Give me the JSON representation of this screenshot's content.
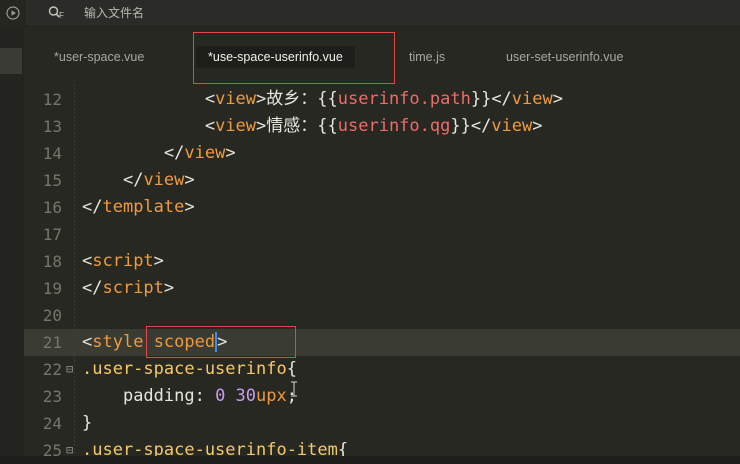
{
  "search": {
    "shortcut_label": "F",
    "placeholder": "输入文件名"
  },
  "tabs": [
    {
      "label": "*user-space.vue",
      "active": false
    },
    {
      "label": "*use-space-userinfo.vue",
      "active": true
    },
    {
      "label": "time.js",
      "active": false
    },
    {
      "label": "user-set-userinfo.vue",
      "active": false
    }
  ],
  "editor": {
    "lines": [
      {
        "num": "12",
        "fold": "",
        "indent": "            ",
        "tokens": [
          [
            "t-tag",
            "<"
          ],
          [
            "t-name",
            "view"
          ],
          [
            "t-tag",
            ">"
          ],
          [
            "t-text",
            "故乡："
          ],
          [
            "t-punct",
            "{{"
          ],
          [
            "t-var",
            "userinfo.path"
          ],
          [
            "t-punct",
            "}}"
          ],
          [
            "t-tag",
            "</"
          ],
          [
            "t-name",
            "view"
          ],
          [
            "t-tag",
            ">"
          ]
        ]
      },
      {
        "num": "13",
        "fold": "",
        "indent": "            ",
        "tokens": [
          [
            "t-tag",
            "<"
          ],
          [
            "t-name",
            "view"
          ],
          [
            "t-tag",
            ">"
          ],
          [
            "t-text",
            "情感："
          ],
          [
            "t-punct",
            "{{"
          ],
          [
            "t-var",
            "userinfo.qg"
          ],
          [
            "t-punct",
            "}}"
          ],
          [
            "t-tag",
            "</"
          ],
          [
            "t-name",
            "view"
          ],
          [
            "t-tag",
            ">"
          ]
        ]
      },
      {
        "num": "14",
        "fold": "",
        "indent": "        ",
        "tokens": [
          [
            "t-tag",
            "</"
          ],
          [
            "t-name",
            "view"
          ],
          [
            "t-tag",
            ">"
          ]
        ]
      },
      {
        "num": "15",
        "fold": "",
        "indent": "    ",
        "tokens": [
          [
            "t-tag",
            "</"
          ],
          [
            "t-name",
            "view"
          ],
          [
            "t-tag",
            ">"
          ]
        ]
      },
      {
        "num": "16",
        "fold": "",
        "indent": "",
        "tokens": [
          [
            "t-tag",
            "</"
          ],
          [
            "t-name",
            "template"
          ],
          [
            "t-tag",
            ">"
          ]
        ]
      },
      {
        "num": "17",
        "fold": "",
        "indent": "",
        "tokens": []
      },
      {
        "num": "18",
        "fold": "",
        "indent": "",
        "tokens": [
          [
            "t-tag",
            "<"
          ],
          [
            "t-name",
            "script"
          ],
          [
            "t-tag",
            ">"
          ]
        ]
      },
      {
        "num": "19",
        "fold": "",
        "indent": "",
        "tokens": [
          [
            "t-tag",
            "</"
          ],
          [
            "t-name",
            "script"
          ],
          [
            "t-tag",
            ">"
          ]
        ]
      },
      {
        "num": "20",
        "fold": "",
        "indent": "",
        "tokens": []
      },
      {
        "num": "21",
        "fold": "",
        "indent": "",
        "active": true,
        "tokens": [
          [
            "t-tag",
            "<"
          ],
          [
            "t-name",
            "style"
          ],
          [
            "t-text",
            " "
          ],
          [
            "t-name",
            "scoped"
          ],
          [
            "cursor",
            ""
          ],
          [
            "t-tag",
            ">"
          ]
        ]
      },
      {
        "num": "22",
        "fold": "⊟",
        "indent": "",
        "tokens": [
          [
            "t-sel",
            ".user-space-userinfo"
          ],
          [
            "t-punct",
            "{"
          ]
        ]
      },
      {
        "num": "23",
        "fold": "",
        "indent": "    ",
        "tokens": [
          [
            "t-text",
            "padding: "
          ],
          [
            "t-num",
            "0 30"
          ],
          [
            "t-unit",
            "upx"
          ],
          [
            "t-punct",
            ";"
          ]
        ]
      },
      {
        "num": "24",
        "fold": "",
        "indent": "",
        "tokens": [
          [
            "t-punct",
            "}"
          ]
        ]
      },
      {
        "num": "25",
        "fold": "⊟",
        "indent": "",
        "tokens": [
          [
            "t-sel",
            ".user-space-userinfo-item"
          ],
          [
            "t-punct",
            "{"
          ]
        ]
      }
    ]
  }
}
